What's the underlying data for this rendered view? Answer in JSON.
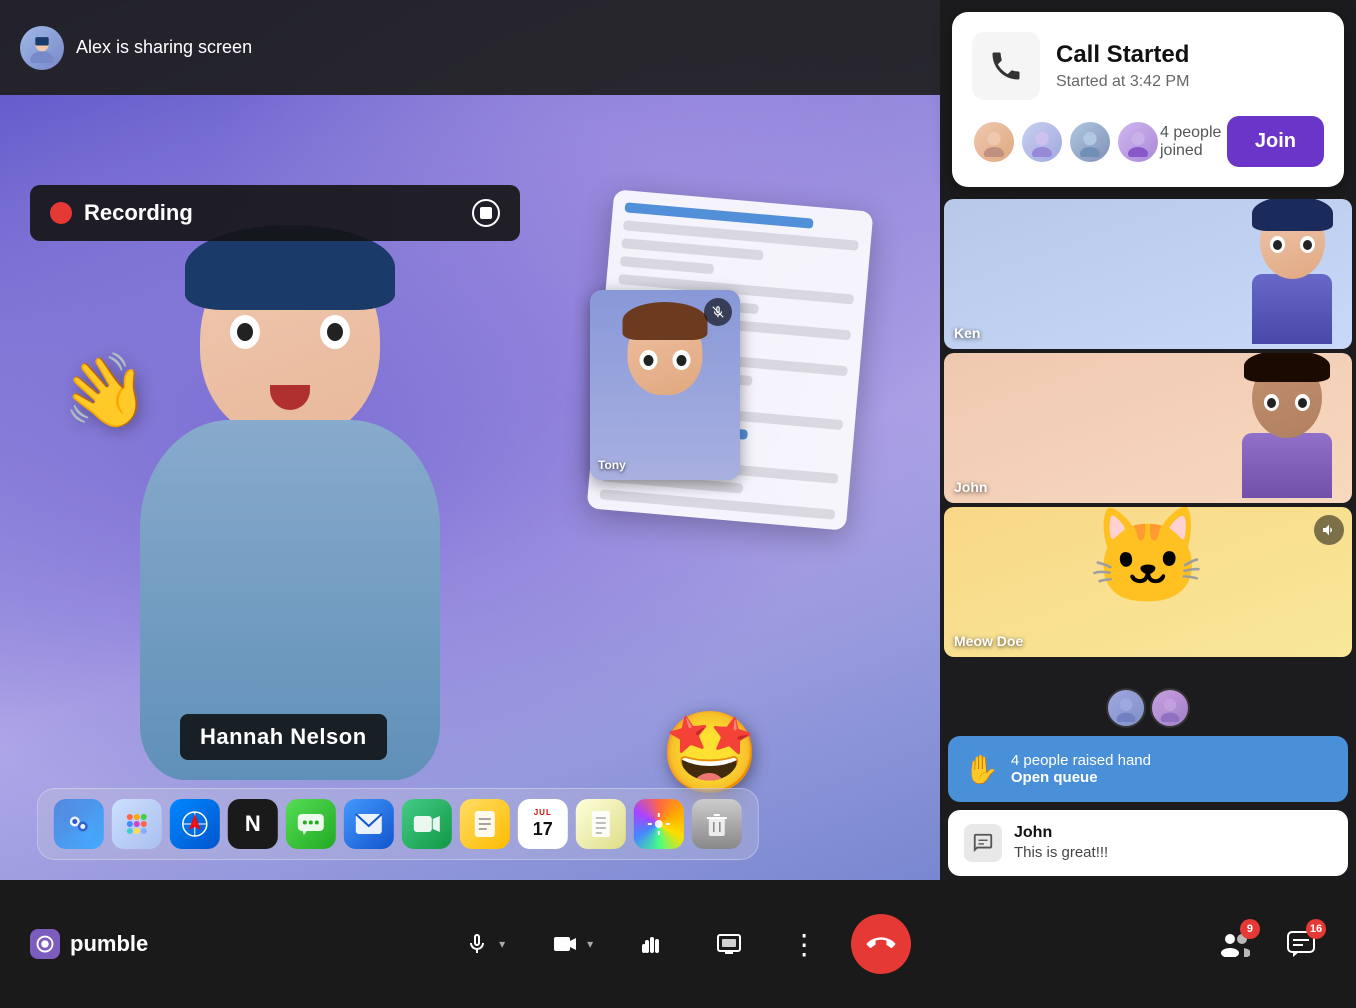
{
  "app": {
    "title": "pumble",
    "logo_icon": "💬"
  },
  "alex_banner": {
    "text": "Alex is sharing screen",
    "avatar_emoji": "🙂"
  },
  "recording": {
    "label": "Recording",
    "dot_color": "#e53935",
    "stop_button_title": "Stop recording"
  },
  "hannah_label": "Hannah Nelson",
  "tony_label": "Tony",
  "call_started": {
    "title": "Call Started",
    "subtitle": "Started at 3:42 PM",
    "phone_icon": "📞",
    "people_joined": "4 people joined",
    "join_label": "Join"
  },
  "participants": [
    {
      "name": "Ken",
      "bg": "ken"
    },
    {
      "name": "John",
      "bg": "john"
    },
    {
      "name": "Meow Doe",
      "bg": "meow"
    }
  ],
  "raised_hand": {
    "icon": "✋",
    "count_text": "4 people raised hand",
    "action_label": "Open queue"
  },
  "chat_message": {
    "sender": "John",
    "text": "This is great!!!",
    "chat_icon": "💬"
  },
  "toolbar": {
    "mic_icon": "🎤",
    "camera_icon": "📷",
    "hand_icon": "✋",
    "screen_icon": "⬛",
    "more_icon": "⋮",
    "end_call_icon": "📞",
    "participants_badge": "9",
    "chat_badge": "16"
  },
  "dock": [
    {
      "id": "finder",
      "emoji": "🖥",
      "class": "di-finder"
    },
    {
      "id": "launchpad",
      "emoji": "⚏",
      "class": "di-launchpad"
    },
    {
      "id": "safari",
      "emoji": "🧭",
      "class": "di-safari"
    },
    {
      "id": "notion",
      "emoji": "N",
      "class": "di-notion"
    },
    {
      "id": "messages",
      "emoji": "💬",
      "class": "di-messages"
    },
    {
      "id": "mail",
      "emoji": "✉",
      "class": "di-mail"
    },
    {
      "id": "facetime",
      "emoji": "📹",
      "class": "di-facetime"
    },
    {
      "id": "notes",
      "emoji": "📋",
      "class": "di-notes"
    },
    {
      "id": "calendar",
      "emoji": "17",
      "class": "di-calendar"
    },
    {
      "id": "notepad",
      "emoji": "📓",
      "class": "di-notepad"
    },
    {
      "id": "photos",
      "emoji": "📸",
      "class": "di-photos"
    },
    {
      "id": "trash",
      "emoji": "🗑",
      "class": "di-trash"
    }
  ]
}
